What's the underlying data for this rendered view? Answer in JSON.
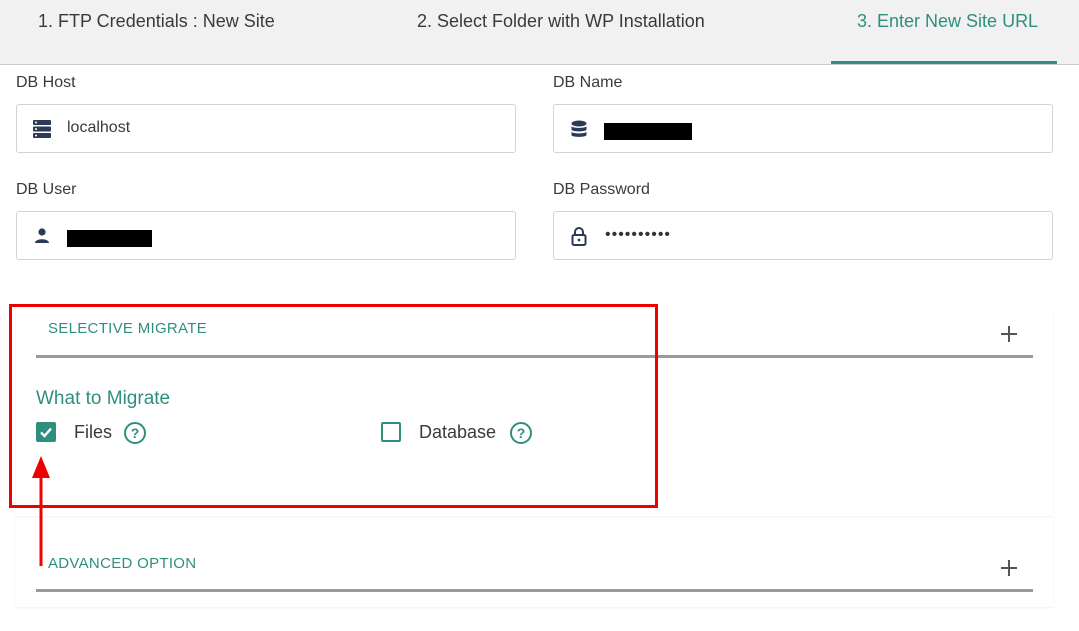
{
  "steps": [
    {
      "label": "1. FTP Credentials : New Site"
    },
    {
      "label": "2. Select Folder with WP Installation"
    },
    {
      "label": "3. Enter New Site URL"
    }
  ],
  "fields": {
    "db_host": {
      "label": "DB Host",
      "value": "localhost",
      "icon": "server-icon"
    },
    "db_name": {
      "label": "DB Name",
      "value": "",
      "icon": "database-icon"
    },
    "db_user": {
      "label": "DB User",
      "value": "",
      "icon": "user-icon"
    },
    "db_password": {
      "label": "DB Password",
      "value": "••••••••••",
      "icon": "lock-icon"
    }
  },
  "selective_migrate": {
    "title": "SELECTIVE MIGRATE",
    "what_title": "What to Migrate",
    "options": [
      {
        "label": "Files",
        "checked": true
      },
      {
        "label": "Database",
        "checked": false
      }
    ]
  },
  "advanced_option": {
    "title": "ADVANCED OPTION"
  },
  "colors": {
    "accent": "#2f8f7e",
    "highlight": "#ee0000"
  }
}
